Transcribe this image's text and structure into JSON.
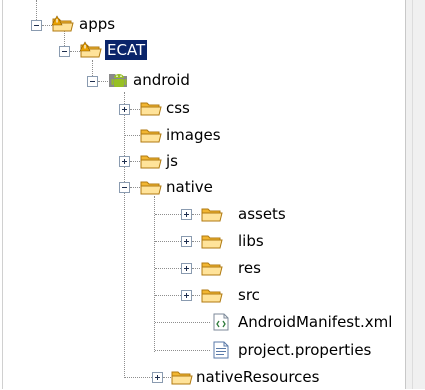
{
  "tree": {
    "nodes": [
      {
        "label": "apps",
        "icon": "folder-warning-icon",
        "state": "expanded"
      },
      {
        "label": "ECAT",
        "icon": "folder-warning-icon",
        "state": "expanded",
        "selected": true
      },
      {
        "label": "android",
        "icon": "android-icon",
        "state": "expanded"
      },
      {
        "label": "css",
        "icon": "folder-icon",
        "state": "collapsed"
      },
      {
        "label": "images",
        "icon": "folder-icon",
        "state": "leaf"
      },
      {
        "label": "js",
        "icon": "folder-icon",
        "state": "collapsed"
      },
      {
        "label": "native",
        "icon": "folder-icon",
        "state": "expanded"
      },
      {
        "label": "assets",
        "icon": "folder-icon",
        "state": "collapsed"
      },
      {
        "label": "libs",
        "icon": "folder-icon",
        "state": "collapsed"
      },
      {
        "label": "res",
        "icon": "folder-icon",
        "state": "collapsed"
      },
      {
        "label": "src",
        "icon": "folder-icon",
        "state": "collapsed"
      },
      {
        "label": "AndroidManifest.xml",
        "icon": "xml-file-icon",
        "state": "leaf"
      },
      {
        "label": "project.properties",
        "icon": "text-file-icon",
        "state": "leaf"
      },
      {
        "label": "nativeResources",
        "icon": "folder-icon",
        "state": "collapsed"
      }
    ]
  },
  "colors": {
    "folder": "#f2b632",
    "folder_light": "#ffe39a",
    "warning": "#e8a000",
    "android": "#97c024",
    "selection_bg": "#0a246a",
    "selection_fg": "#ffffff"
  }
}
